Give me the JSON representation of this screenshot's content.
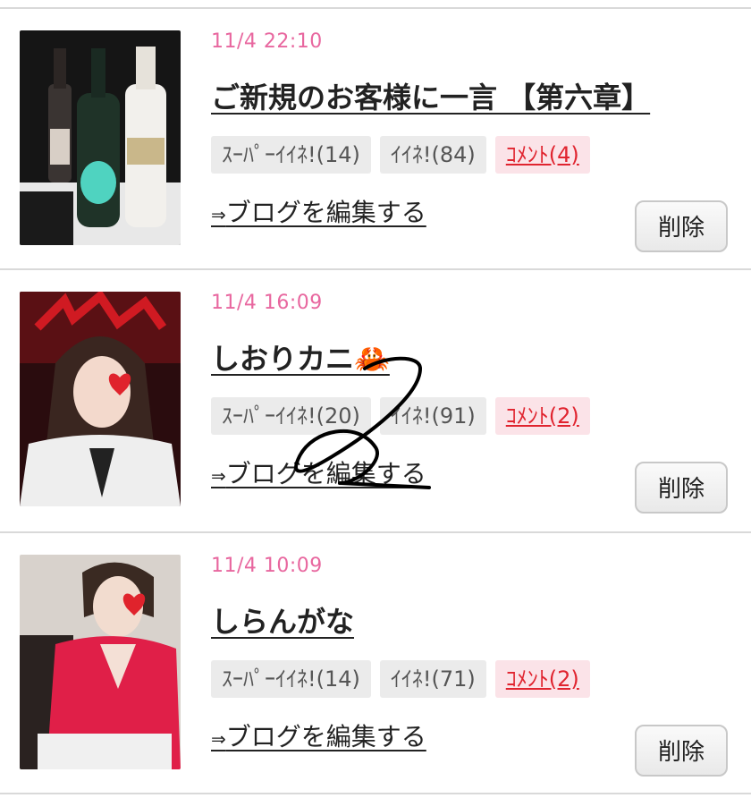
{
  "posts": [
    {
      "time": "11/4 22:10",
      "title": "ご新規のお客様に一言 【第六章】",
      "super_like": "ｽｰﾊﾟｰｲｲﾈ!(14)",
      "like": "ｲｲﾈ!(84)",
      "comment": "ｺﾒﾝﾄ(4)",
      "edit_label": "ブログを編集する",
      "edit_arrow": "⇒",
      "delete_label": "削除",
      "thumb": "wine-bottles"
    },
    {
      "time": "11/4 16:09",
      "title": "しおりカニ🦀",
      "super_like": "ｽｰﾊﾟｰｲｲﾈ!(20)",
      "like": "ｲｲﾈ!(91)",
      "comment": "ｺﾒﾝﾄ(2)",
      "edit_label": "ブログを編集する",
      "edit_arrow": "⇒",
      "delete_label": "削除",
      "thumb": "woman-with-crab-hat"
    },
    {
      "time": "11/4 10:09",
      "title": "しらんがな",
      "super_like": "ｽｰﾊﾟｰｲｲﾈ!(14)",
      "like": "ｲｲﾈ!(71)",
      "comment": "ｺﾒﾝﾄ(2)",
      "edit_label": "ブログを編集する",
      "edit_arrow": "⇒",
      "delete_label": "削除",
      "thumb": "woman-in-red-jacket"
    }
  ],
  "colors": {
    "time": "#e8679f",
    "comment": "#e0242f",
    "badge_bg": "#ebebeb"
  },
  "annotation": "handwritten-2"
}
